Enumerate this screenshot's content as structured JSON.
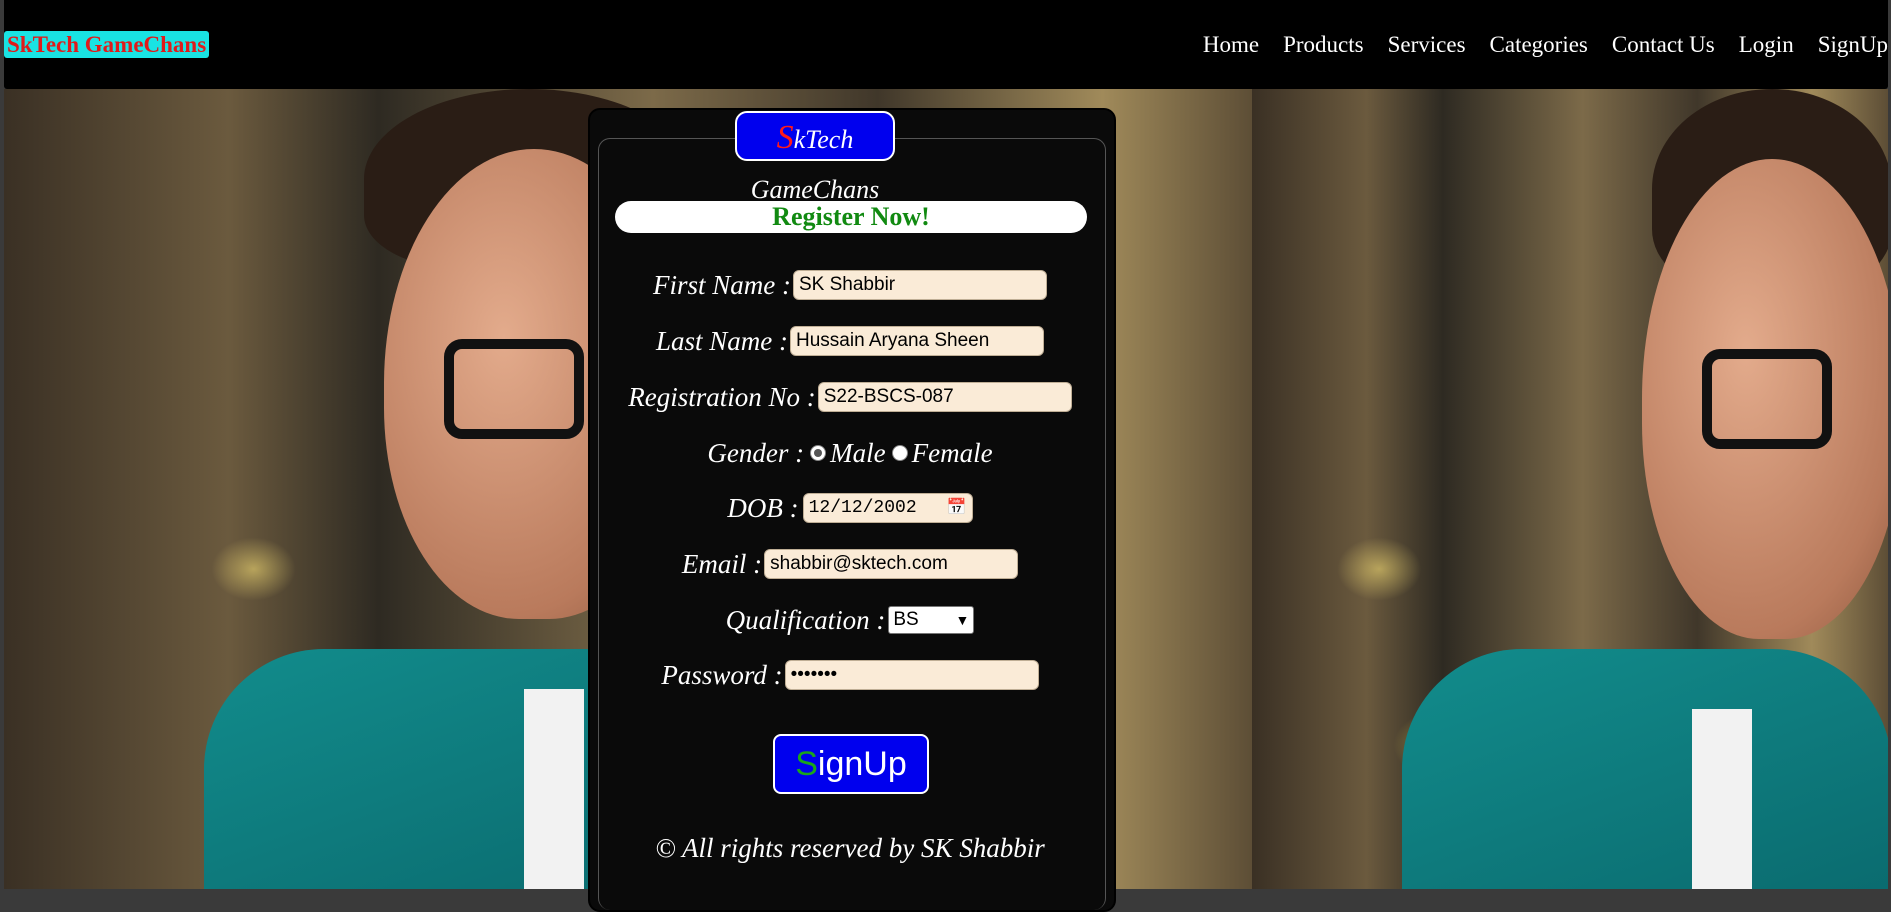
{
  "header": {
    "brand": "SkTech GameChans",
    "nav": [
      "Home",
      "Products",
      "Services",
      "Categories",
      "Contact Us",
      "Login",
      "SignUp"
    ]
  },
  "form": {
    "logo_initial": "S",
    "logo_rest": "kTech GameChans",
    "heading": "Register Now!",
    "first_name_label": "First Name :",
    "first_name_value": "SK Shabbir",
    "last_name_label": "Last Name :",
    "last_name_value": "Hussain Aryana Sheen",
    "reg_label": "Registration No :",
    "reg_value": "S22-BSCS-087",
    "gender_label": "Gender :",
    "gender_male": "Male",
    "gender_female": "Female",
    "gender_selected": "Male",
    "dob_label": "DOB :",
    "dob_value": "12/12/2002",
    "email_label": "Email :",
    "email_value": "shabbir@sktech.com",
    "qualification_label": "Qualification :",
    "qualification_value": "BS",
    "password_label": "Password :",
    "password_value": "•••••••",
    "submit_initial": "S",
    "submit_rest": "ignUp",
    "footer": "© All rights reserved by SK Shabbir"
  },
  "icons": {
    "date": "calendar-icon",
    "select": "chevron-down-icon"
  },
  "colors": {
    "navbar": "#000000",
    "brand_bg": "#19e3e3",
    "brand_text": "#e01a1a",
    "badge_bg": "#0000ee",
    "heading_text": "#118a11",
    "input_bg": "#faebd7"
  }
}
